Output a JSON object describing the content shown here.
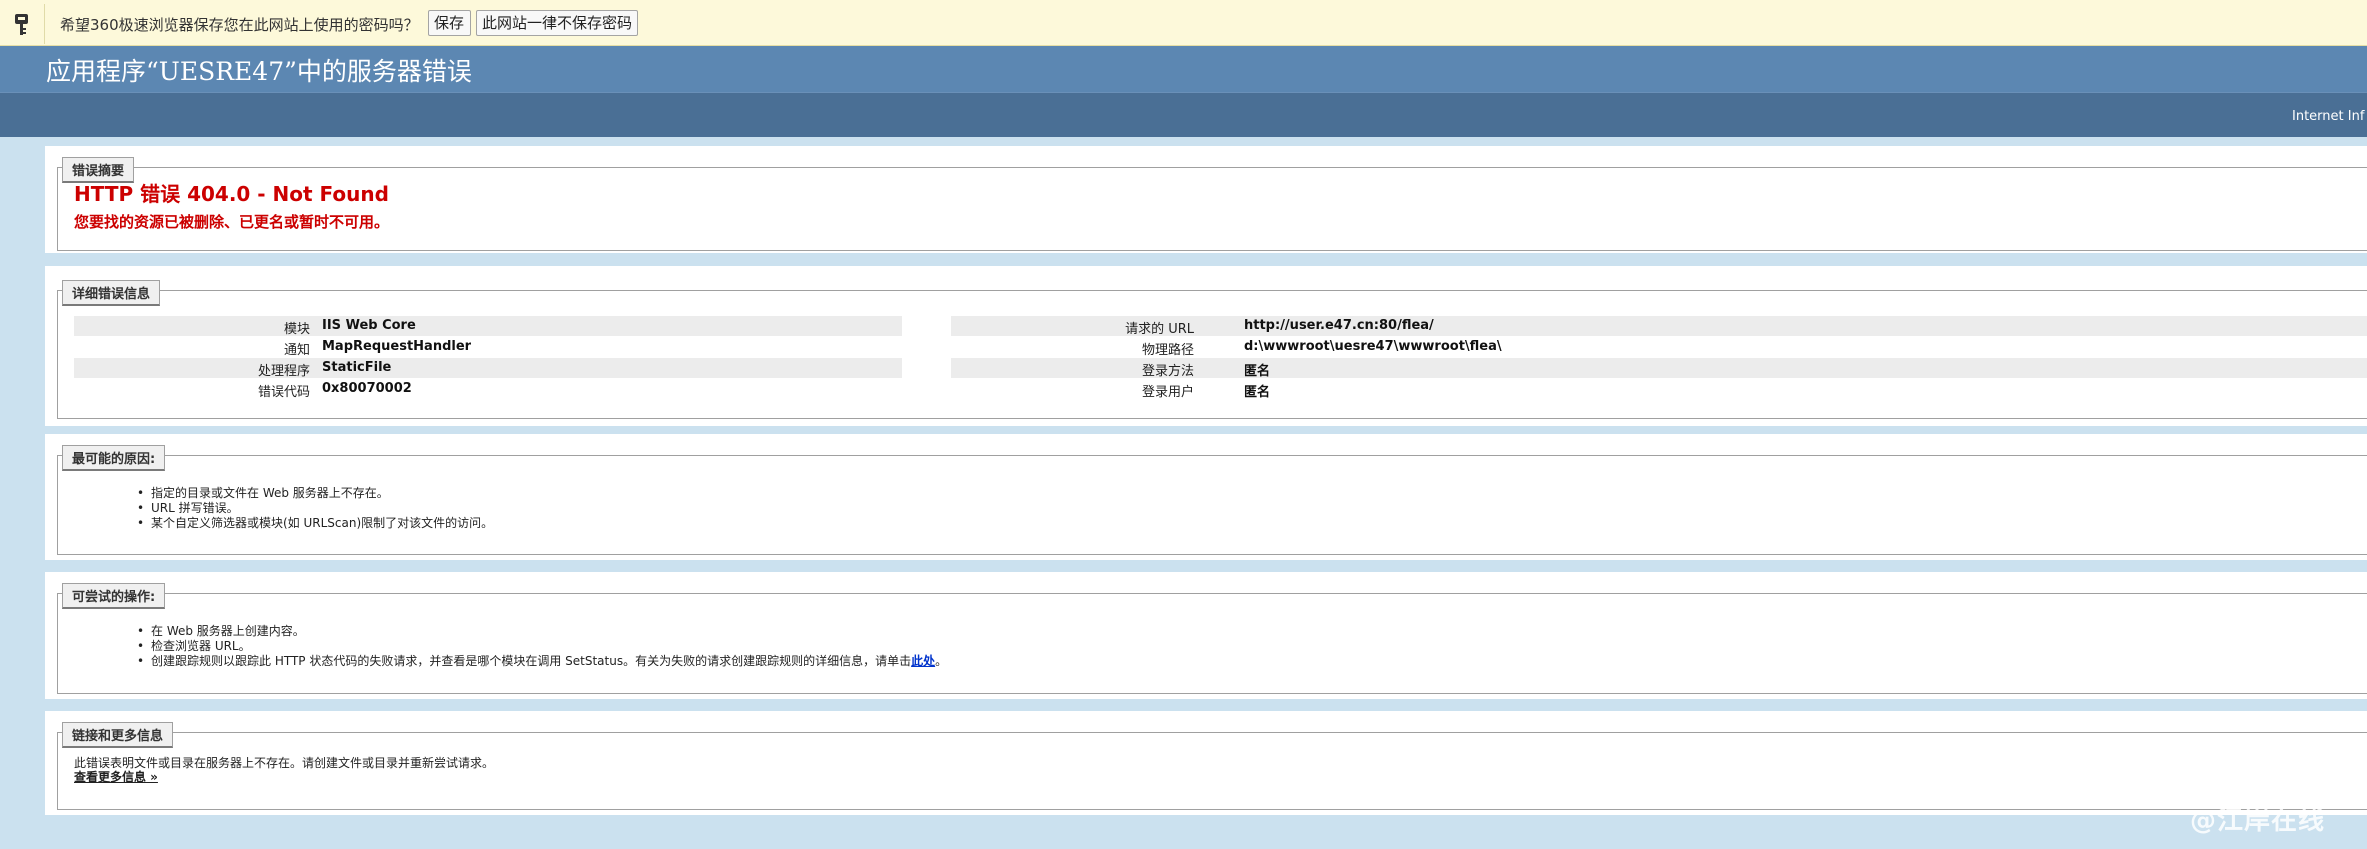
{
  "password_bar": {
    "message": "希望360极速浏览器保存您在此网站上使用的密码吗？",
    "save_label": "保存",
    "never_label": "此网站一律不保存密码",
    "icon": "key-icon"
  },
  "header": {
    "title": "应用程序“UESRE47”中的服务器错误",
    "product": "Internet Inf"
  },
  "summary": {
    "legend": "错误摘要",
    "error_title": "HTTP 错误 404.0 - Not Found",
    "error_desc": "您要找的资源已被删除、已更名或暂时不可用。"
  },
  "details": {
    "legend": "详细错误信息",
    "left": [
      {
        "key": "模块",
        "value": "IIS Web Core"
      },
      {
        "key": "通知",
        "value": "MapRequestHandler"
      },
      {
        "key": "处理程序",
        "value": "StaticFile"
      },
      {
        "key": "错误代码",
        "value": "0x80070002"
      }
    ],
    "right": [
      {
        "key": "请求的 URL",
        "value": "http://user.e47.cn:80/flea/"
      },
      {
        "key": "物理路径",
        "value": "d:\\wwwroot\\uesre47\\wwwroot\\flea\\"
      },
      {
        "key": "登录方法",
        "value": "匿名"
      },
      {
        "key": "登录用户",
        "value": "匿名"
      }
    ]
  },
  "causes": {
    "legend": "最可能的原因:",
    "items": [
      "指定的目录或文件在 Web 服务器上不存在。",
      "URL 拼写错误。",
      "某个自定义筛选器或模块(如 URLScan)限制了对该文件的访问。"
    ]
  },
  "actions": {
    "legend": "可尝试的操作:",
    "items": [
      "在 Web 服务器上创建内容。",
      "检查浏览器 URL。"
    ],
    "item3_prefix": "创建跟踪规则以跟踪此 HTTP 状态代码的失败请求，并查看是哪个模块在调用 SetStatus。有关为失败的请求创建跟踪规则的详细信息，请单击",
    "item3_link": "此处",
    "item3_suffix": "。"
  },
  "links": {
    "legend": "链接和更多信息",
    "text": "此错误表明文件或目录在服务器上不存在。请创建文件或目录并重新尝试请求。",
    "more_link": "查看更多信息 »"
  },
  "watermark": "@江岸在线"
}
